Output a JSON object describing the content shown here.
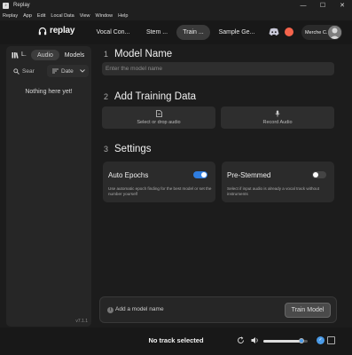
{
  "window": {
    "title": "Replay",
    "controls": [
      "—",
      "☐",
      "✕"
    ]
  },
  "menu": [
    "Replay",
    "App",
    "Edit",
    "Local Data",
    "View",
    "Window",
    "Help"
  ],
  "header": {
    "logo_text": "replay",
    "tabs": [
      {
        "label": "Vocal Con..."
      },
      {
        "label": "Stem ..."
      },
      {
        "label": "Train ..."
      },
      {
        "label": "Sample Ge..."
      }
    ],
    "active_tab": "Train ...",
    "user_name": "Merche C.",
    "accent_color": "#f5644c"
  },
  "sidebar": {
    "library_label": "L.",
    "segments": [
      "Audio",
      "Models"
    ],
    "active_segment": "Audio",
    "search_placeholder": "Sear",
    "sort_label": "Date",
    "empty_message": "Nothing here yet!",
    "version": "v7.1.1"
  },
  "main": {
    "step1": {
      "num": "1",
      "title": "Model Name",
      "placeholder": "Enter the model name"
    },
    "step2": {
      "num": "2",
      "title": "Add Training Data",
      "select_label": "Select or drop audio",
      "record_label": "Record Audio"
    },
    "step3": {
      "num": "3",
      "title": "Settings",
      "auto_epochs": {
        "title": "Auto Epochs",
        "desc": "Use automatic epoch finding for the best model or set the number yourself",
        "enabled": true
      },
      "pre_stemmed": {
        "title": "Pre-Stemmed",
        "desc": "Select if input audio is already a vocal track without instruments",
        "enabled": false
      }
    },
    "footer": {
      "hint": "Add a model name",
      "train_label": "Train Model"
    }
  },
  "player": {
    "track": "No track selected",
    "volume": 0.85,
    "accent_color": "#2f7de0"
  }
}
